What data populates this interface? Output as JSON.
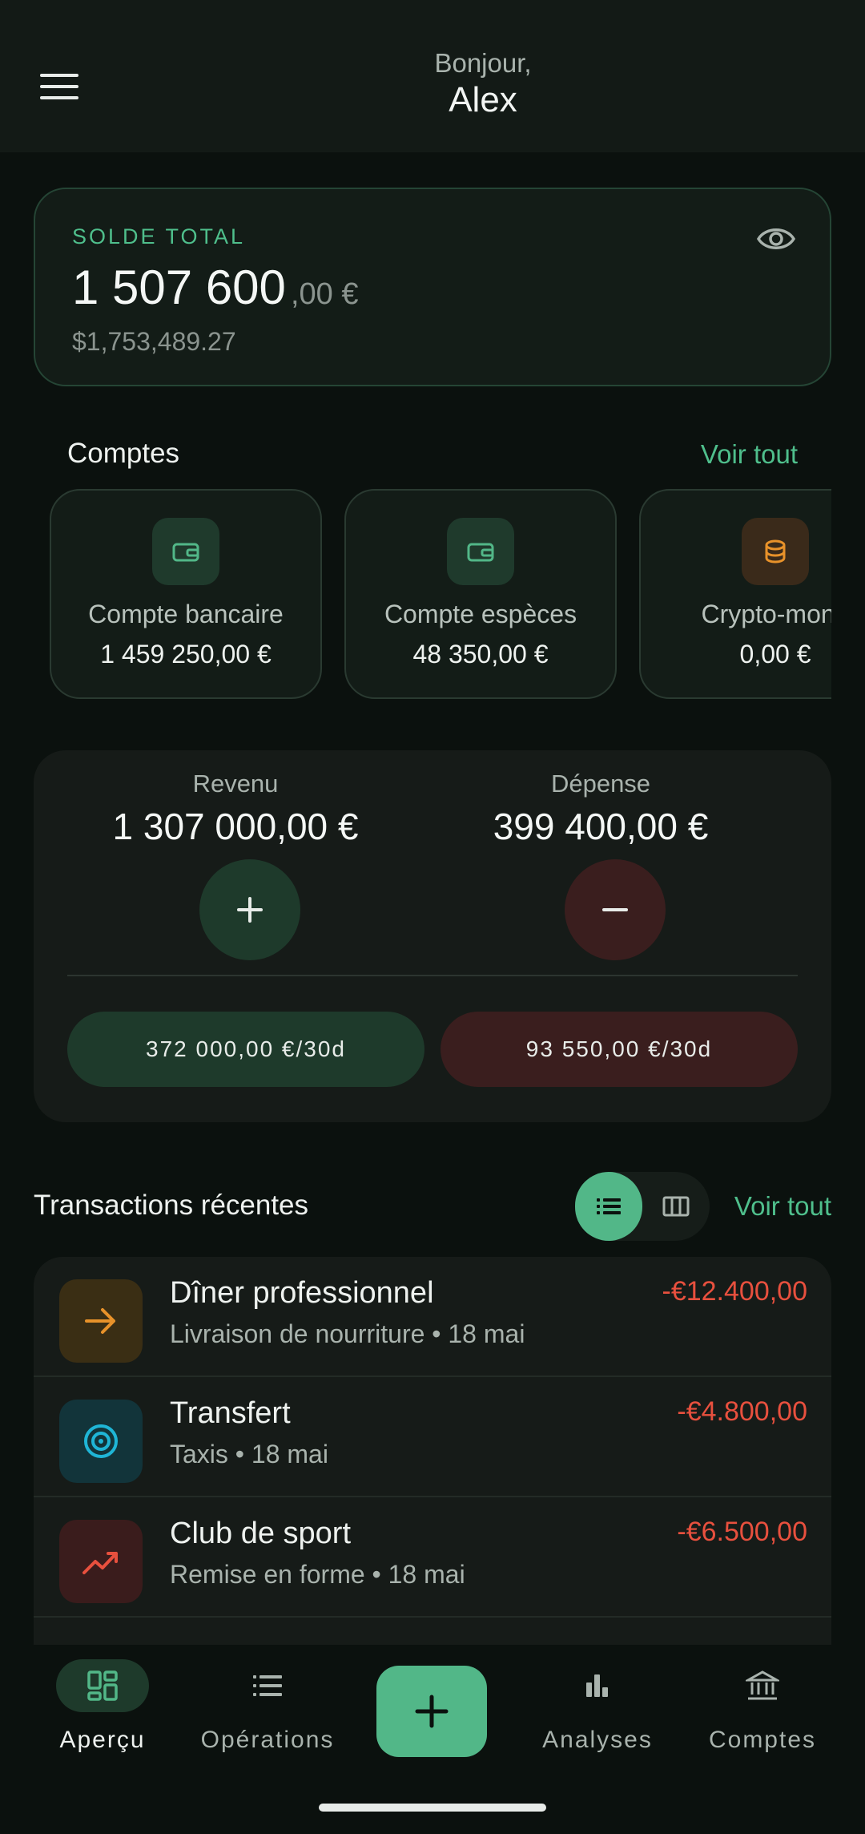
{
  "header": {
    "greeting": "Bonjour,",
    "name": "Alex"
  },
  "balance": {
    "label": "SOLDE TOTAL",
    "amount": "1 507 600",
    "cents": ",00 €",
    "usd": "$1,753,489.27"
  },
  "accounts_section": {
    "title": "Comptes",
    "link": "Voir tout",
    "items": [
      {
        "name": "Compte bancaire",
        "value": "1 459 250,00 €",
        "icon": "wallet-icon",
        "color": "#52b788"
      },
      {
        "name": "Compte espèces",
        "value": "48 350,00 €",
        "icon": "wallet-icon",
        "color": "#52b788"
      },
      {
        "name": "Crypto-monn",
        "value": "0,00 €",
        "icon": "coins-icon",
        "color": "#e8922a"
      }
    ]
  },
  "flow": {
    "income_label": "Revenu",
    "income_value": "1 307 000,00 €",
    "expense_label": "Dépense",
    "expense_value": "399 400,00 €",
    "income_30d": "372 000,00 €/30d",
    "expense_30d": "93 550,00 €/30d"
  },
  "transactions": {
    "title": "Transactions récentes",
    "link": "Voir tout",
    "items": [
      {
        "title": "Dîner professionnel",
        "subtitle": "Livraison de nourriture • 18 mai",
        "amount": "-€12.400,00",
        "icon": "arrow-right-icon"
      },
      {
        "title": "Transfert",
        "subtitle": "Taxis • 18 mai",
        "amount": "-€4.800,00",
        "icon": "target-icon"
      },
      {
        "title": "Club de sport",
        "subtitle": "Remise en forme • 18 mai",
        "amount": "-€6.500,00",
        "icon": "trending-up-icon"
      },
      {
        "title": "",
        "subtitle": "",
        "amount": "",
        "icon": "partial-row"
      }
    ]
  },
  "nav": {
    "items": [
      {
        "label": "Aperçu",
        "icon": "dashboard-icon",
        "active": true
      },
      {
        "label": "Opérations",
        "icon": "list-icon"
      },
      {
        "label": "Analyses",
        "icon": "bar-chart-icon"
      },
      {
        "label": "Comptes",
        "icon": "bank-icon"
      }
    ],
    "fab": "add-icon"
  },
  "colors": {
    "accent": "#52b788",
    "expense": "#e8503e",
    "background": "#0b110e"
  }
}
